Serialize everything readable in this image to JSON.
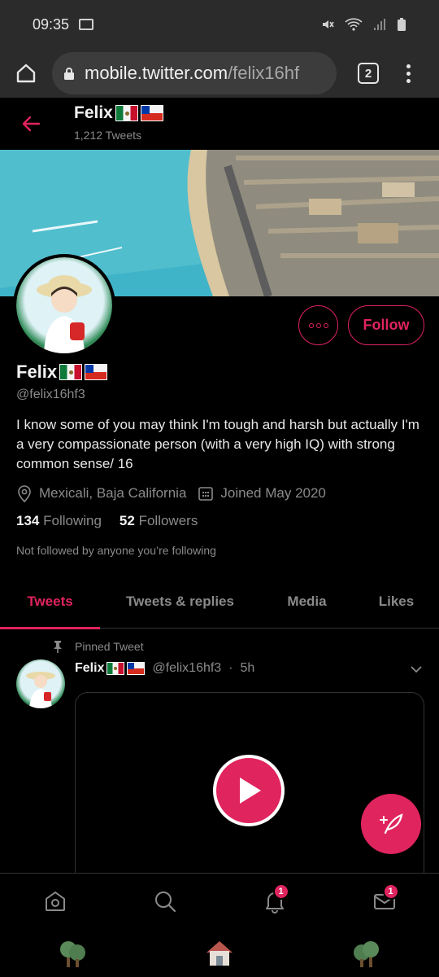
{
  "status_bar": {
    "time": "09:35"
  },
  "browser": {
    "url_host": "mobile.twitter.com",
    "url_path": "/felix16hf",
    "tab_count": "2"
  },
  "header": {
    "name": "Felix",
    "tweet_count": "1,212 Tweets"
  },
  "profile": {
    "name": "Felix",
    "handle": "@felix16hf3",
    "follow_label": "Follow",
    "bio": "I know some of you may think I'm tough and harsh but actually I'm a very compassionate person (with a very high IQ) with strong common sense/ 16",
    "location": "Mexicali, Baja California",
    "joined": "Joined May 2020",
    "following_count": "134",
    "following_label": "Following",
    "followers_count": "52",
    "followers_label": "Followers",
    "not_followed": "Not followed by anyone you’re following"
  },
  "tabs": [
    {
      "label": "Tweets",
      "active": true
    },
    {
      "label": "Tweets & replies",
      "active": false
    },
    {
      "label": "Media",
      "active": false
    },
    {
      "label": "Likes",
      "active": false
    }
  ],
  "tweet": {
    "pinned_label": "Pinned Tweet",
    "name": "Felix",
    "handle": "@felix16hf3",
    "time": "5h"
  },
  "bottom_nav": {
    "notifications_badge": "1",
    "messages_badge": "1"
  },
  "colors": {
    "accent": "#e0245e",
    "background": "#000000",
    "secondary_text": "#8a8a8a"
  }
}
